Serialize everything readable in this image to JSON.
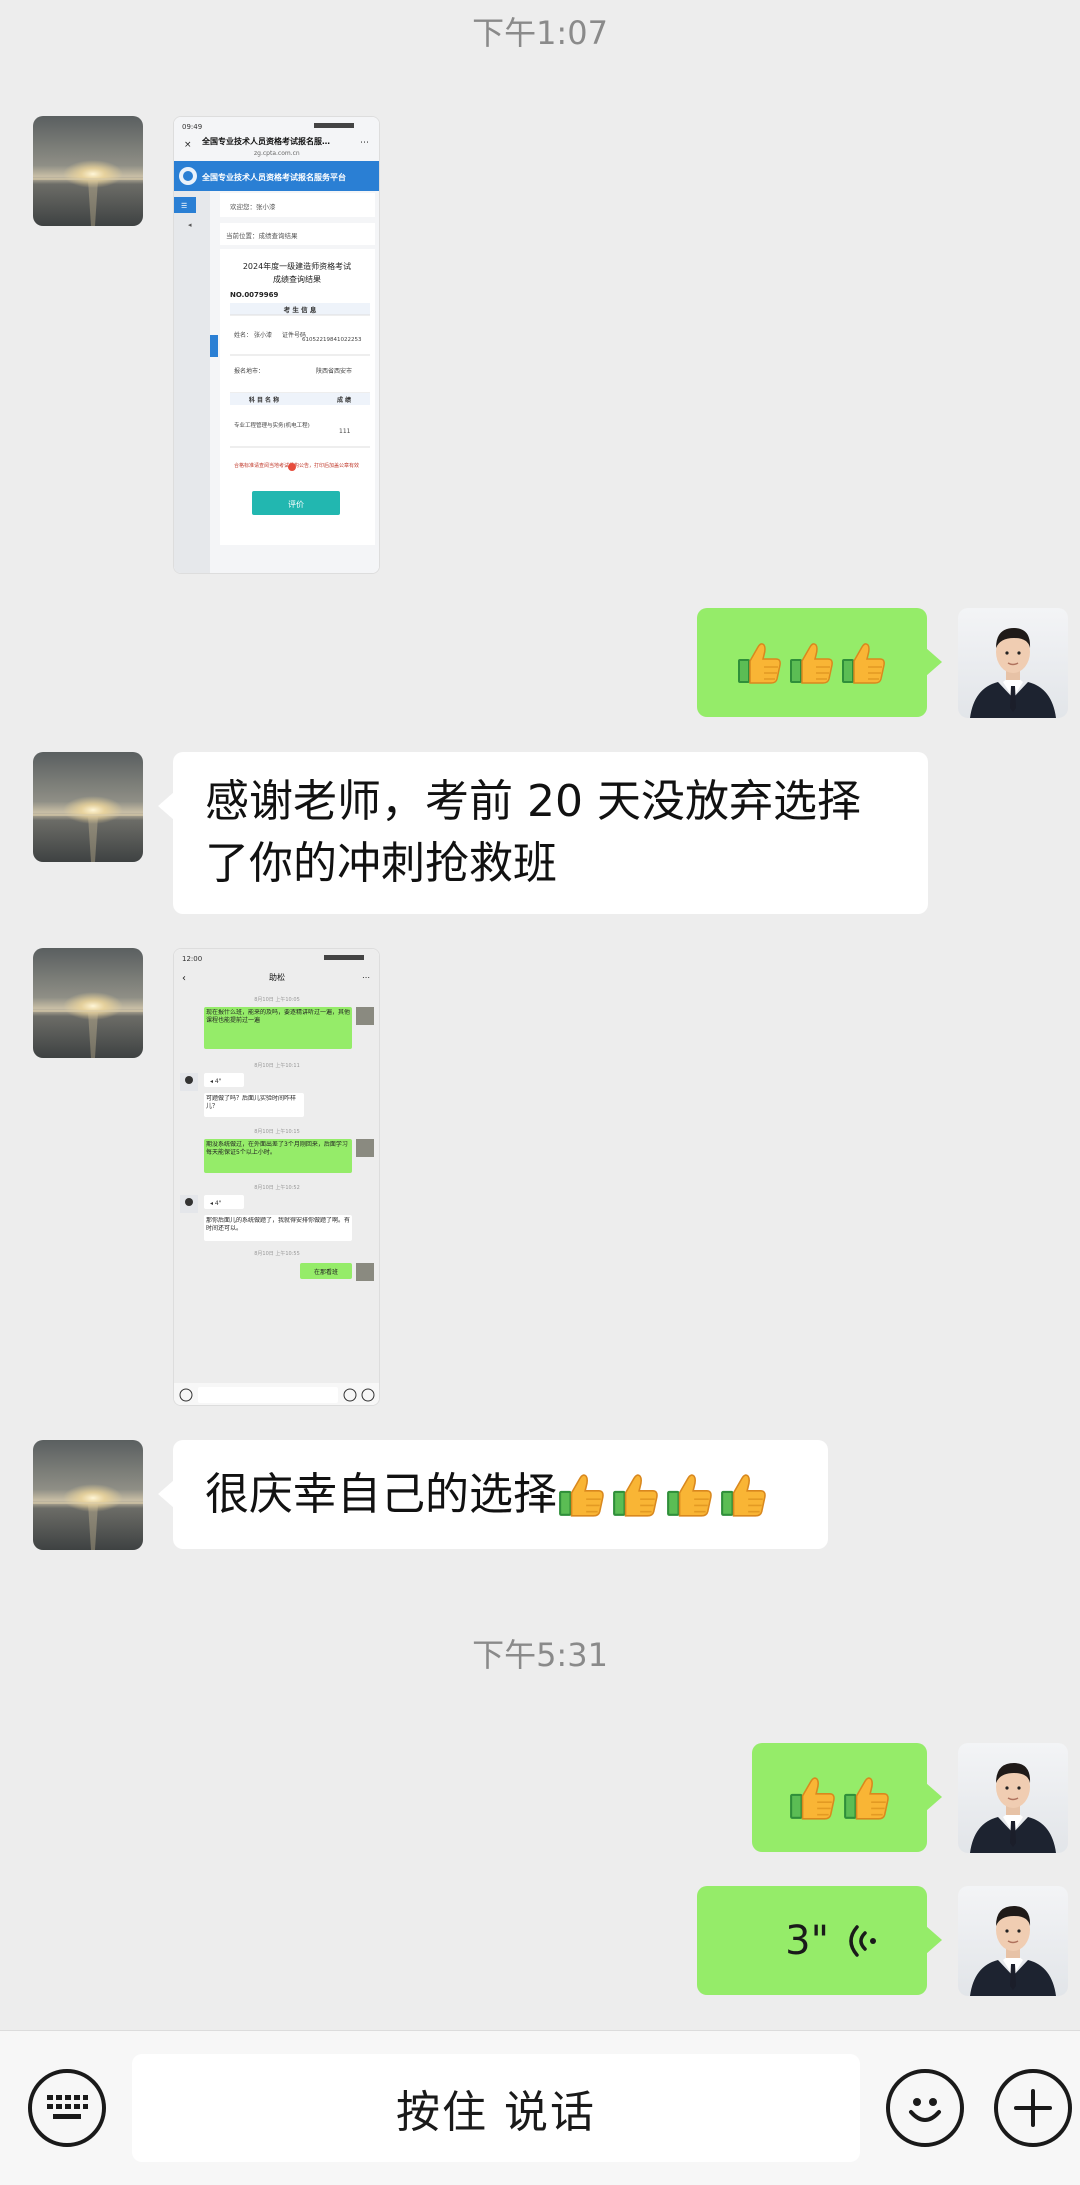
{
  "timestamps": [
    "下午1:07",
    "下午5:31"
  ],
  "messages": {
    "msg_thanks": "感谢老师，考前 20 天没放弃选择了你的冲刺抢救班",
    "msg_lucky": "很庆幸自己的选择",
    "voice_duration": "3\""
  },
  "emoji_name": "thumbs-up",
  "screenshot1": {
    "status_time": "09:49",
    "page_title": "全国专业技术人员资格考试报名服…",
    "page_url": "zg.cpta.com.cn",
    "banner": "全国专业技术人员资格考试报名服务平台",
    "welcome": "欢迎您：张小漆",
    "location": "当前位置：成绩查询结果",
    "result_title_1": "2024年度一级建造师资格考试",
    "result_title_2": "成绩查询结果",
    "number": "NO.0079969",
    "section_header": "考 生 信 息",
    "name_label": "姓名：",
    "name_value": "张小漆",
    "id_label": "证件号码",
    "id_value": "61052219841022253",
    "place_label": "报名地市：",
    "place_value": "陕西省西安市",
    "subject_label": "科 目 名 称",
    "score_label": "成 绩",
    "subject_value": "专业工程管理与实务(机电工程)",
    "score_value": "111",
    "note": "合格标准请查阅当地考试机构公告，打印后加盖公章有效",
    "button": "评价"
  },
  "screenshot2": {
    "status_time": "12:00",
    "chat_title": "助松",
    "m1": "现在报什么班，能来的及吗，要逐精讲听过一遍，其他课程也能提前过一遍",
    "t1": "8月10日 上午10:11",
    "v1": "4\"",
    "m2": "可题做了吗？后面儿实验时间咋样儿？",
    "t2": "8月10日 上午10:15",
    "m3": "期没系统做过，在外面出差了3个月刚回来，后面学习每天能保证5个以上小时。",
    "t3": "8月10日 上午10:52",
    "v2": "4\"",
    "m4": "那你后面儿的系统做题了，我就得安排你做题了啊。有时间还可以。",
    "t4": "8月10日 上午10:55",
    "m5": "在那看班"
  },
  "input_bar": {
    "hold_to_talk": "按住 说话",
    "left_icon": "keyboard-icon",
    "emoji_icon": "emoji-icon",
    "plus_icon": "plus-icon"
  },
  "colors": {
    "background": "#ededed",
    "bubble_self": "#95ec69",
    "bubble_other": "#ffffff",
    "timestamp_text": "#8a8a8a"
  }
}
